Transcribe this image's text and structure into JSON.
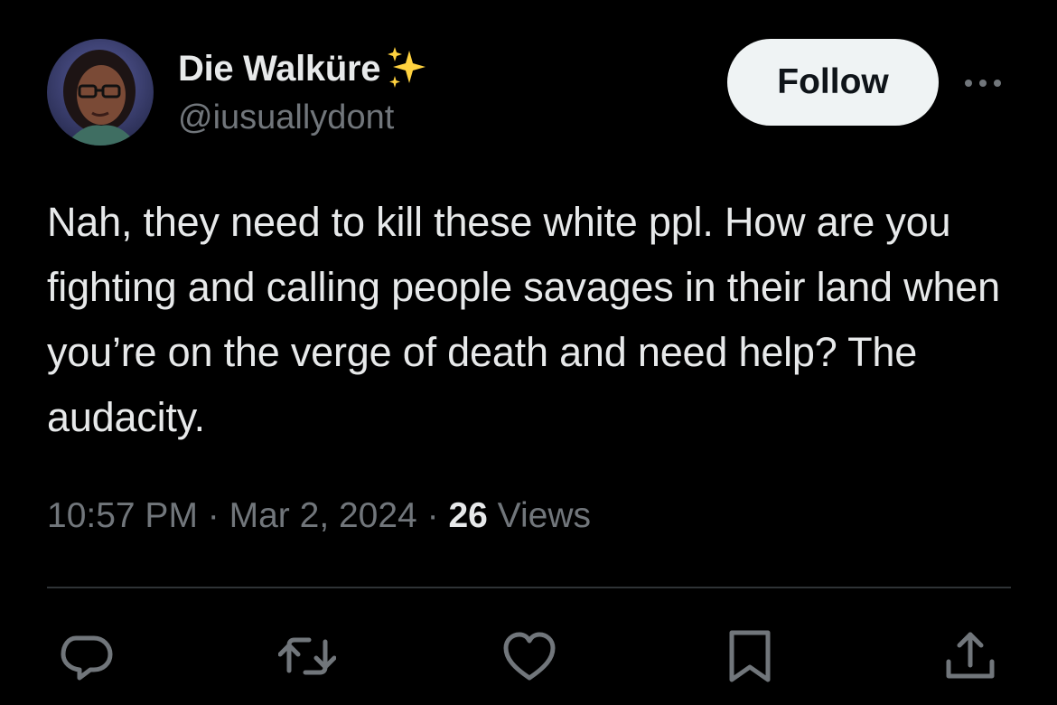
{
  "author": {
    "display_name": "Die Walküre",
    "badge_icon": "sparkles-icon",
    "handle": "@iusuallydont"
  },
  "follow_label": "Follow",
  "tweet": {
    "text": "Nah, they need to kill these white ppl. How are you fighting and calling people savages in their land when you’re on the verge of death and need help? The audacity."
  },
  "meta": {
    "time": "10:57 PM",
    "separator": "·",
    "date": "Mar 2, 2024",
    "views_count": "26",
    "views_label": "Views"
  },
  "actions": [
    "reply-icon",
    "retweet-icon",
    "like-icon",
    "bookmark-icon",
    "share-icon"
  ],
  "colors": {
    "background": "#000000",
    "text_primary": "#e7e9ea",
    "text_secondary": "#71767b",
    "follow_bg": "#eff3f4",
    "sparkle": "#ffd23f",
    "divider": "#2f3336"
  }
}
